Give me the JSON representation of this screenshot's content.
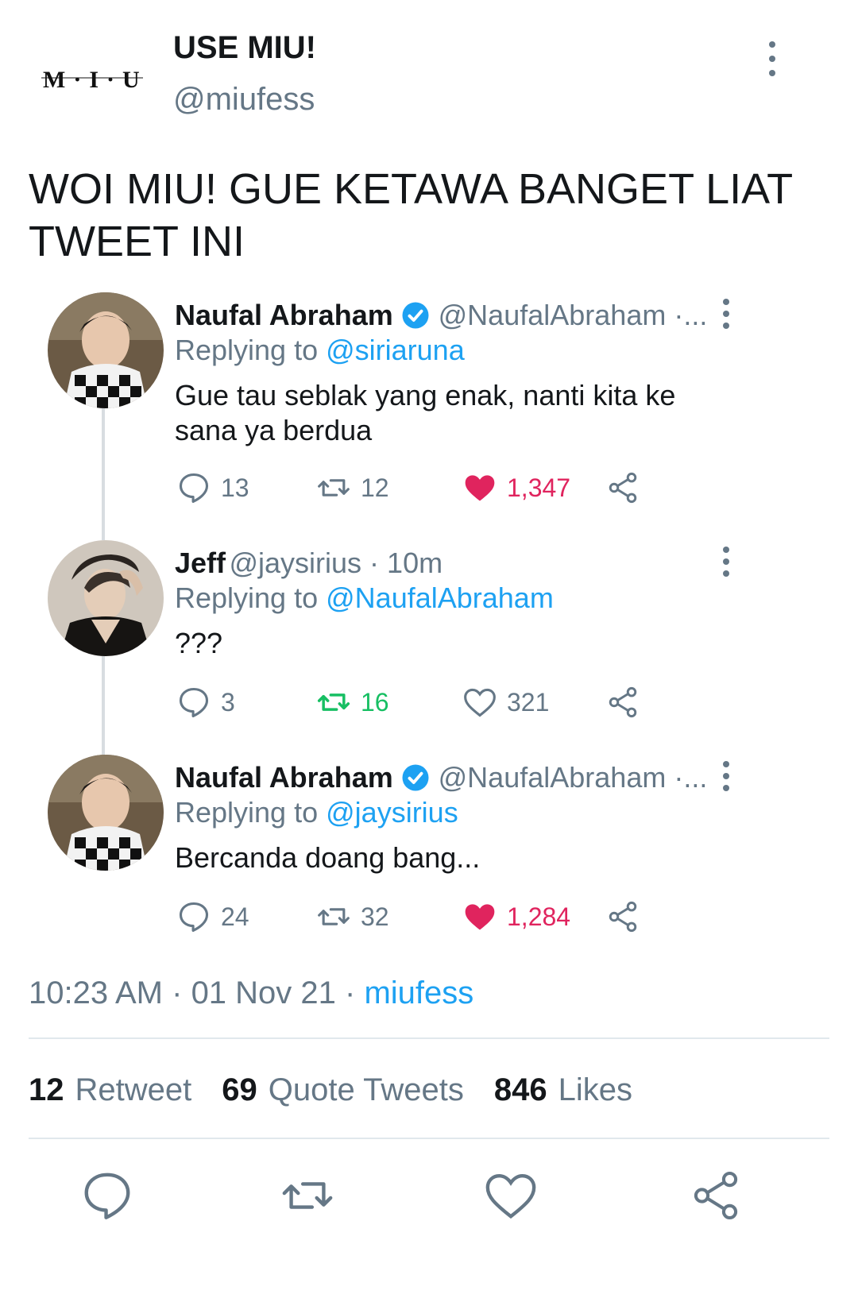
{
  "header": {
    "logo_text": "M·I·U",
    "name": "USE MIU!",
    "handle": "@miufess"
  },
  "tweet_text": "WOI MIU! GUE KETAWA BANGET LIAT TWEET INI",
  "thread": [
    {
      "name": "Naufal Abraham",
      "handle": "@NaufalAbraham ·...",
      "replying_label": "Replying to",
      "replying_to": "@siriaruna",
      "text": "Gue tau seblak yang enak, nanti kita ke sana ya berdua",
      "replies": "13",
      "retweets": "12",
      "likes": "1,347",
      "liked": true
    },
    {
      "name": "Jeff",
      "handle": "@jaysirius · 10m",
      "replying_label": "Replying to",
      "replying_to": "@NaufalAbraham",
      "text": "???",
      "replies": "3",
      "retweets": "16",
      "likes": "321",
      "retweeted": true
    },
    {
      "name": "Naufal Abraham",
      "handle": "@NaufalAbraham ·...",
      "replying_label": "Replying to",
      "replying_to": "@jaysirius",
      "text": "Bercanda doang bang...",
      "replies": "24",
      "retweets": "32",
      "likes": "1,284",
      "liked": true
    }
  ],
  "meta": {
    "time": "10:23 AM",
    "date": "01 Nov 21",
    "source": "miufess"
  },
  "stats": {
    "retweets_count": "12",
    "retweets_label": "Retweet",
    "quotes_count": "69",
    "quotes_label": "Quote Tweets",
    "likes_count": "846",
    "likes_label": "Likes"
  },
  "colors": {
    "accent": "#1da1f2",
    "like": "#e0245e",
    "retweet": "#17bf63",
    "muted": "#657786"
  }
}
